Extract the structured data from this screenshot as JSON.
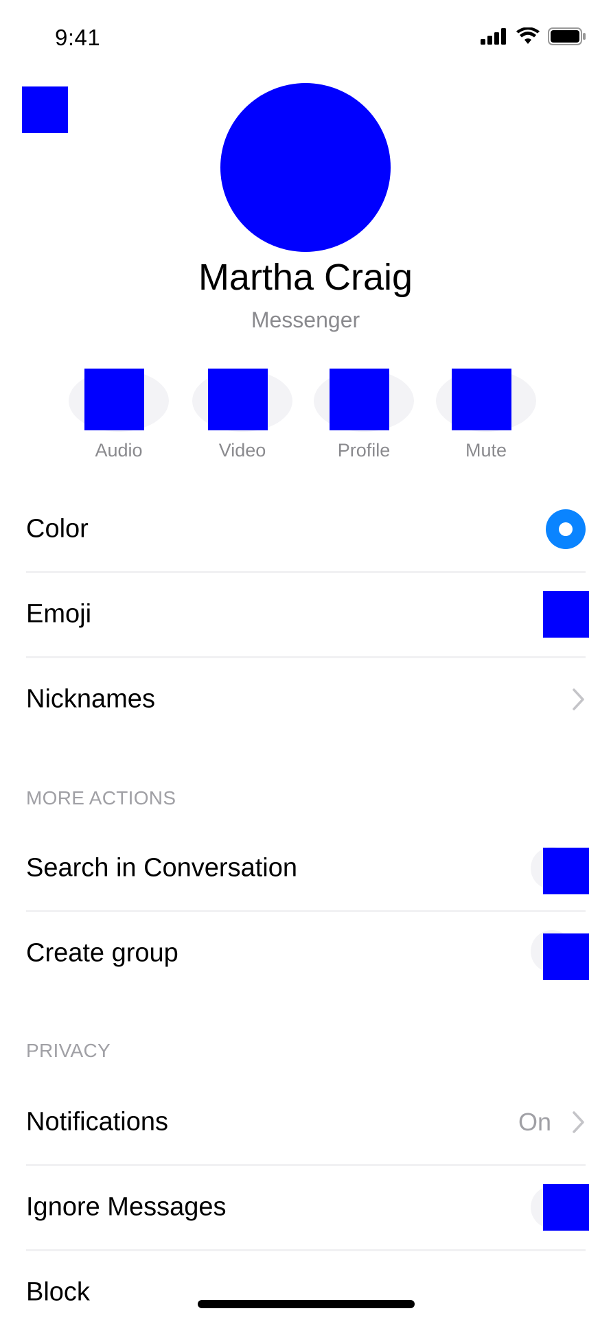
{
  "status_bar": {
    "time": "9:41",
    "signal_icon": "cellular-signal-icon",
    "wifi_icon": "wifi-icon",
    "battery_icon": "battery-icon"
  },
  "header": {
    "back_icon": "back-icon",
    "avatar": "contact-avatar",
    "name": "Martha Craig",
    "subtitle": "Messenger"
  },
  "quick_actions": [
    {
      "label": "Audio",
      "icon": "phone-icon"
    },
    {
      "label": "Video",
      "icon": "video-camera-icon"
    },
    {
      "label": "Profile",
      "icon": "profile-icon"
    },
    {
      "label": "Mute",
      "icon": "bell-icon"
    }
  ],
  "customize": {
    "color_label": "Color",
    "color_value": "#0A84FF",
    "emoji_label": "Emoji",
    "emoji_icon": "emoji-icon",
    "nicknames_label": "Nicknames"
  },
  "more_actions": {
    "title": "MORE ACTIONS",
    "search_label": "Search in Conversation",
    "search_icon": "search-icon",
    "create_group_label": "Create group",
    "create_group_icon": "add-people-icon"
  },
  "privacy": {
    "title": "PRIVACY",
    "notifications_label": "Notifications",
    "notifications_value": "On",
    "ignore_label": "Ignore Messages",
    "ignore_icon": "ignore-icon",
    "block_label": "Block"
  },
  "colors": {
    "accent": "#0A84FF",
    "placeholder": "#0000FF",
    "secondary_text": "#8A8A8E",
    "section_title": "#A0A0A5",
    "divider": "#F1F1F3"
  }
}
